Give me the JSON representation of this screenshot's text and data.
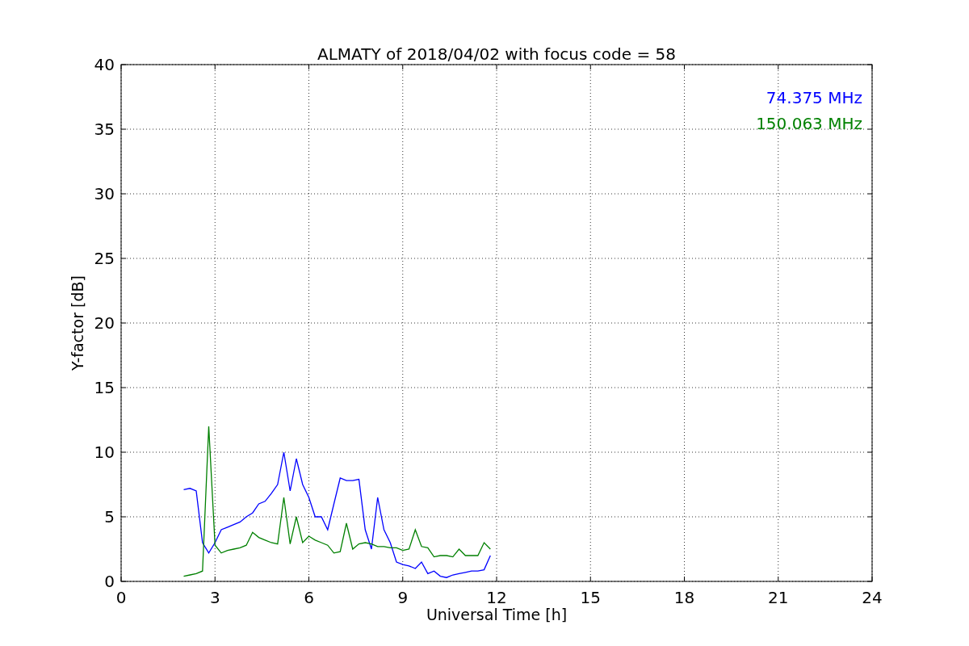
{
  "chart_data": {
    "type": "line",
    "title": "ALMATY of 2018/04/02 with focus code = 58",
    "xlabel": "Universal Time [h]",
    "ylabel": "Y-factor [dB]",
    "x": [
      2.0,
      2.2,
      2.4,
      2.6,
      2.8,
      3.0,
      3.2,
      3.4,
      3.6,
      3.8,
      4.0,
      4.2,
      4.4,
      4.6,
      4.8,
      5.0,
      5.2,
      5.4,
      5.6,
      5.8,
      6.0,
      6.2,
      6.4,
      6.6,
      6.8,
      7.0,
      7.2,
      7.4,
      7.6,
      7.8,
      8.0,
      8.2,
      8.4,
      8.6,
      8.8,
      9.0,
      9.2,
      9.4,
      9.6,
      9.8,
      10.0,
      10.2,
      10.4,
      10.6,
      10.8,
      11.0,
      11.2,
      11.4,
      11.6,
      11.8
    ],
    "series": [
      {
        "name": "74.375 MHz",
        "color": "#0000ff",
        "values": [
          7.1,
          7.2,
          7.0,
          3.0,
          2.2,
          3.0,
          4.0,
          4.2,
          4.4,
          4.6,
          5.0,
          5.3,
          6.0,
          6.2,
          6.8,
          7.5,
          10.0,
          7.0,
          9.5,
          7.5,
          6.5,
          5.0,
          5.0,
          4.0,
          6.0,
          8.0,
          7.8,
          7.8,
          7.9,
          4.0,
          2.5,
          6.5,
          4.0,
          3.0,
          1.5,
          1.3,
          1.2,
          1.0,
          1.5,
          0.6,
          0.8,
          0.4,
          0.3,
          0.5,
          0.6,
          0.7,
          0.8,
          0.8,
          0.9,
          2.0
        ]
      },
      {
        "name": "150.063 MHz",
        "color": "#008000",
        "values": [
          0.4,
          0.5,
          0.6,
          0.8,
          12.0,
          2.8,
          2.2,
          2.4,
          2.5,
          2.6,
          2.8,
          3.8,
          3.4,
          3.2,
          3.0,
          2.9,
          6.5,
          2.9,
          5.0,
          3.0,
          3.5,
          3.2,
          3.0,
          2.8,
          2.2,
          2.3,
          4.5,
          2.5,
          2.9,
          3.0,
          2.9,
          2.7,
          2.7,
          2.6,
          2.6,
          2.4,
          2.5,
          4.0,
          2.7,
          2.6,
          1.9,
          2.0,
          2.0,
          1.9,
          2.5,
          2.0,
          2.0,
          2.0,
          3.0,
          2.5
        ]
      }
    ],
    "xlim": [
      0,
      24
    ],
    "ylim": [
      0,
      40
    ],
    "xticks": [
      0,
      3,
      6,
      9,
      12,
      15,
      18,
      21,
      24
    ],
    "yticks": [
      0,
      5,
      10,
      15,
      20,
      25,
      30,
      35,
      40
    ],
    "grid": true
  }
}
